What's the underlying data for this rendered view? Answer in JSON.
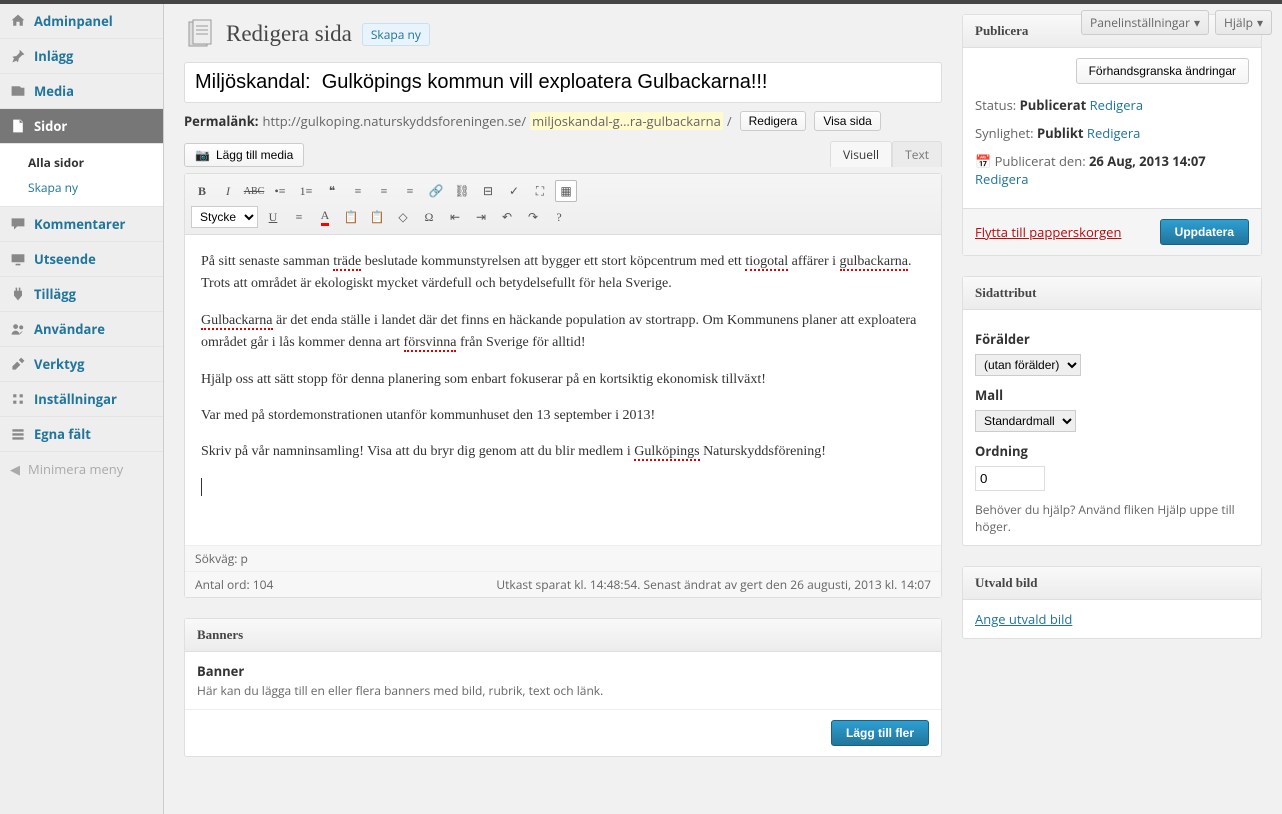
{
  "topbuttons": {
    "screen_options": "Panelinställningar",
    "help": "Hjälp"
  },
  "sidebar": {
    "items": [
      {
        "label": "Adminpanel"
      },
      {
        "label": "Inlägg"
      },
      {
        "label": "Media"
      },
      {
        "label": "Sidor"
      },
      {
        "label": "Kommentarer"
      },
      {
        "label": "Utseende"
      },
      {
        "label": "Tillägg"
      },
      {
        "label": "Användare"
      },
      {
        "label": "Verktyg"
      },
      {
        "label": "Inställningar"
      },
      {
        "label": "Egna fält"
      }
    ],
    "submenu": {
      "all": "Alla sidor",
      "new": "Skapa ny"
    },
    "collapse": "Minimera meny"
  },
  "page": {
    "heading": "Redigera sida",
    "add_new": "Skapa ny",
    "title_value": "Miljöskandal:  Gulköpings kommun vill exploatera Gulbackarna!!!",
    "permalink_label": "Permalänk:",
    "permalink_base": "http://gulkoping.naturskyddsforeningen.se/",
    "permalink_slug": "miljoskandal-g…ra-gulbackarna",
    "permalink_edit": "Redigera",
    "permalink_view": "Visa sida",
    "add_media": "Lägg till media",
    "tabs": {
      "visual": "Visuell",
      "text": "Text"
    },
    "format_select": "Stycke",
    "content": {
      "p1a": "På sitt senaste samman ",
      "p1b": "träde",
      "p1c": " beslutade kommunstyrelsen att bygger ett stort köpcentrum med ett ",
      "p1d": "tiogotal",
      "p1e": " affärer i ",
      "p1f": "gulbackarna",
      "p1g": ". Trots att området är ekologiskt mycket värdefull och betydelsefullt för hela Sverige.",
      "p2a": "Gulbackarna",
      "p2b": " är det enda ställe i landet där det finns en häckande population av stortrapp. Om Kommunens planer att exploatera området går i lås kommer denna art ",
      "p2c": "försvinna",
      "p2d": " från Sverige för alltid!",
      "p3": "Hjälp oss att sätt stopp för denna planering som enbart fokuserar på en kortsiktig ekonomisk tillväxt!",
      "p4": "Var med på stordemonstrationen utanför kommunhuset den 13 september i 2013!",
      "p5a": "Skriv på vår namninsamling! Visa att du bryr dig genom att du blir medlem i ",
      "p5b": "Gulköpings",
      "p5c": " Naturskyddsförening!"
    },
    "path_label": "Sökväg: p",
    "word_count_label": "Antal ord: 104",
    "draft_saved": "Utkast sparat kl. 14:48:54. Senast ändrat av gert den 26 augusti, 2013 kl. 14:07"
  },
  "publish": {
    "box_title": "Publicera",
    "preview": "Förhandsgranska ändringar",
    "status_label": "Status:",
    "status_value": "Publicerat",
    "status_edit": "Redigera",
    "visibility_label": "Synlighet:",
    "visibility_value": "Publikt",
    "visibility_edit": "Redigera",
    "date_label": "Publicerat den:",
    "date_value": "26 Aug, 2013 14:07",
    "date_edit": "Redigera",
    "trash": "Flytta till papperskorgen",
    "update": "Uppdatera"
  },
  "attributes": {
    "box_title": "Sidattribut",
    "parent_label": "Förälder",
    "parent_value": "(utan förälder)",
    "template_label": "Mall",
    "template_value": "Standardmall",
    "order_label": "Ordning",
    "order_value": "0",
    "help": "Behöver du hjälp? Använd fliken Hjälp uppe till höger."
  },
  "featured": {
    "box_title": "Utvald bild",
    "set_link": "Ange utvald bild"
  },
  "banners": {
    "box_title": "Banners",
    "sub_title": "Banner",
    "sub_desc": "Här kan du lägga till en eller flera banners med bild, rubrik, text och länk.",
    "add_more": "Lägg till fler"
  }
}
